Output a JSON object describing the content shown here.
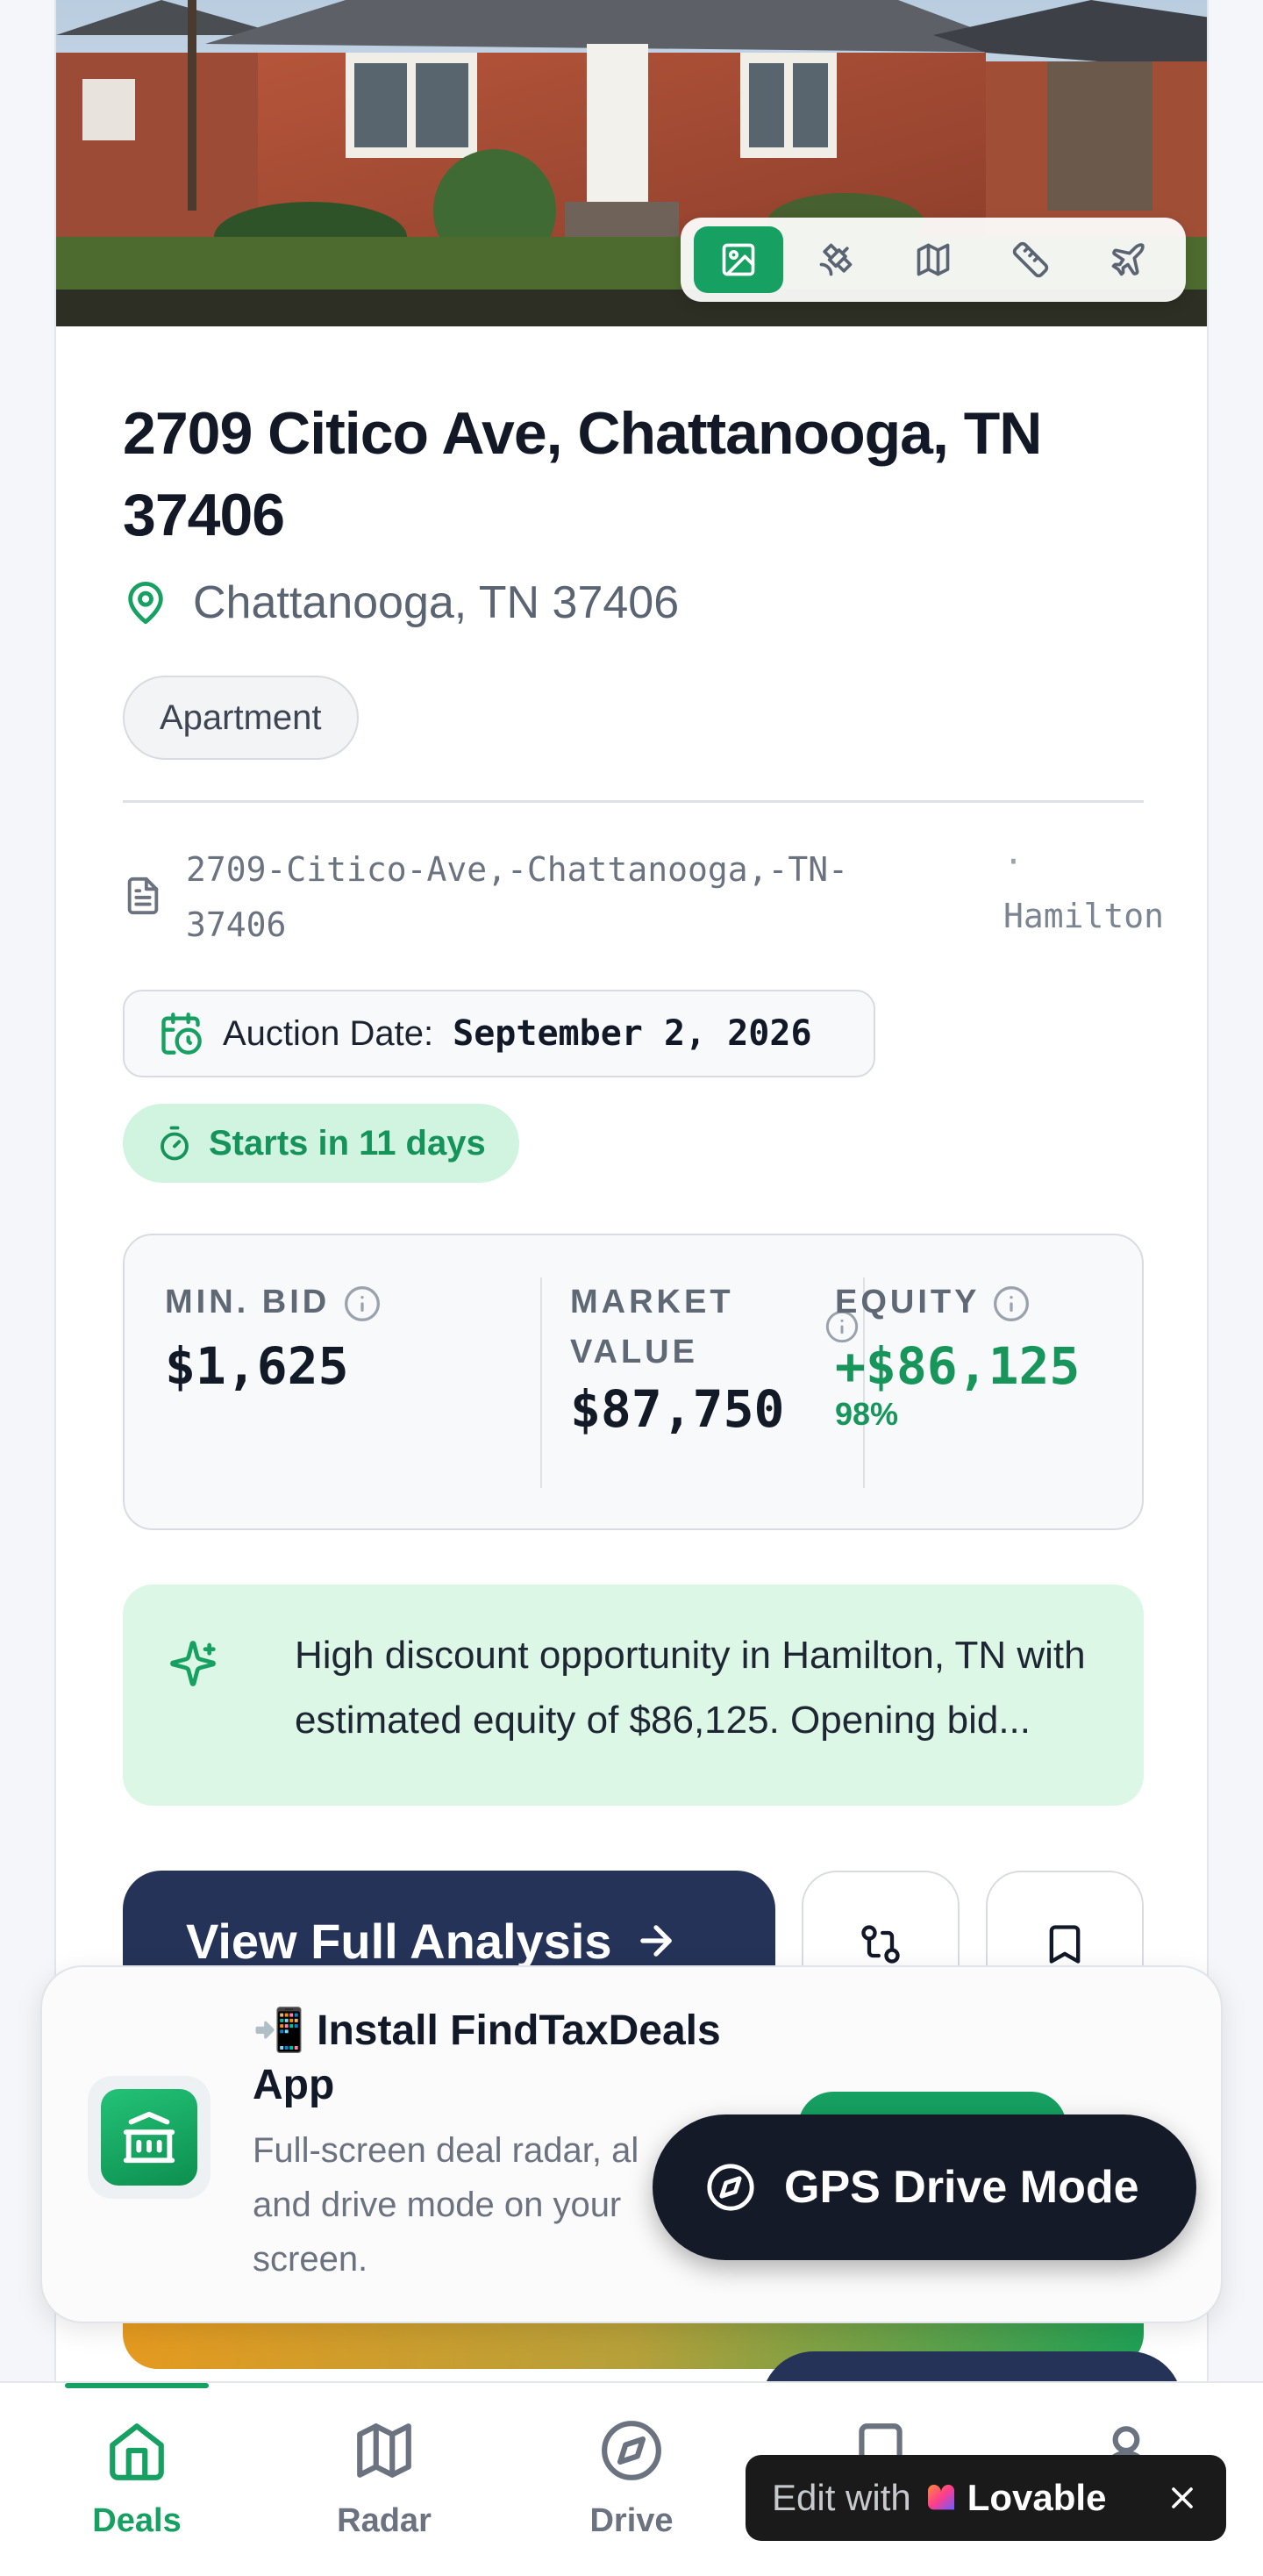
{
  "media_toolbar": {
    "buttons": [
      {
        "icon": "photo-icon",
        "active": true
      },
      {
        "icon": "satellite-icon",
        "active": false
      },
      {
        "icon": "map-icon",
        "active": false
      },
      {
        "icon": "ruler-icon",
        "active": false
      },
      {
        "icon": "plane-icon",
        "active": false
      }
    ]
  },
  "property": {
    "title": "2709 Citico Ave, Chattanooga, TN 37406",
    "location": "Chattanooga, TN 37406",
    "type": "Apartment",
    "parcel": "2709-Citico-Ave,-Chattanooga,-TN-37406",
    "separator": "·",
    "county": "Hamilton"
  },
  "auction": {
    "label": "Auction Date:",
    "date": "September 2, 2026",
    "countdown": "Starts in 11 days"
  },
  "metrics": {
    "min_bid": {
      "label": "MIN. BID",
      "value": "$1,625"
    },
    "market_value": {
      "label_line1": "MARKET",
      "label_line2": "VALUE",
      "value": "$87,750"
    },
    "equity": {
      "label": "EQUITY",
      "value": "+$86,125",
      "percent": "98%"
    }
  },
  "insight": {
    "line1": "High discount opportunity in Hamilton, TN with",
    "line2": "estimated equity of $86,125. Opening bid..."
  },
  "actions": {
    "primary_label": "View Full Analysis"
  },
  "install_banner": {
    "title_line1": "📲 Install FindTaxDeals",
    "title_line2": "App",
    "desc_line1": "Full-screen deal radar, al",
    "desc_line2": "and drive mode on your",
    "desc_line3": "screen."
  },
  "gps": {
    "label": "GPS Drive Mode"
  },
  "bottom_nav": {
    "items": [
      {
        "label": "Deals",
        "icon": "home-icon",
        "active": true
      },
      {
        "label": "Radar",
        "icon": "map-icon",
        "active": false
      },
      {
        "label": "Drive",
        "icon": "compass-icon",
        "active": false
      }
    ]
  },
  "lovable_badge": {
    "edit_text": "Edit with",
    "brand": "Lovable"
  },
  "colors": {
    "accent_green": "#16a061",
    "navy": "#253358",
    "dark": "#141a27"
  }
}
